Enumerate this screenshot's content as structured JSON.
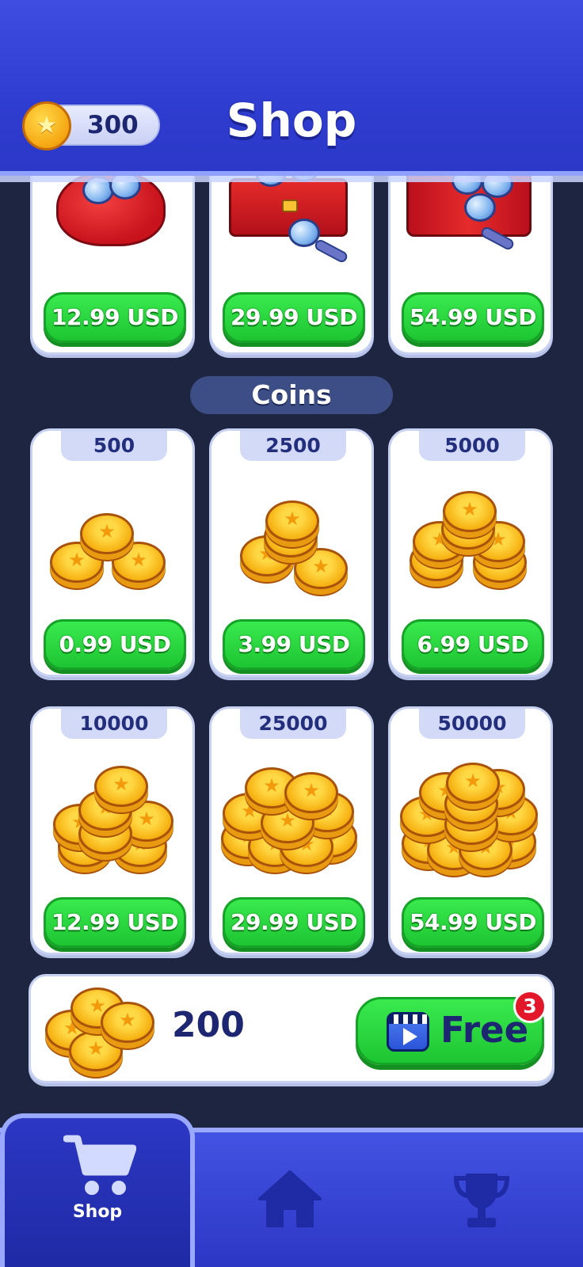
{
  "header": {
    "title": "Shop",
    "balance": "300"
  },
  "treasure_packs": [
    {
      "price": "12.99 USD",
      "icon": "coin-bag-icon"
    },
    {
      "price": "29.99 USD",
      "icon": "treasure-chest-icon"
    },
    {
      "price": "54.99 USD",
      "icon": "safe-vault-icon"
    }
  ],
  "section": {
    "label": "Coins"
  },
  "coin_packs": [
    {
      "amount": "500",
      "price": "0.99 USD"
    },
    {
      "amount": "2500",
      "price": "3.99 USD"
    },
    {
      "amount": "5000",
      "price": "6.99 USD"
    },
    {
      "amount": "10000",
      "price": "12.99 USD"
    },
    {
      "amount": "25000",
      "price": "29.99 USD"
    },
    {
      "amount": "50000",
      "price": "54.99 USD"
    }
  ],
  "free_reward": {
    "amount": "200",
    "button_label": "Free",
    "badge_count": "3"
  },
  "nav": {
    "items": [
      {
        "label": "Shop",
        "icon": "cart-icon",
        "active": true
      },
      {
        "label": "",
        "icon": "home-icon",
        "active": false
      },
      {
        "label": "",
        "icon": "trophy-icon",
        "active": false
      }
    ]
  },
  "colors": {
    "header_blue": "#3f4ee0",
    "background": "#1e2540",
    "buy_green": "#1ec532",
    "coin_gold": "#f7b516",
    "badge_red": "#e3172a"
  }
}
